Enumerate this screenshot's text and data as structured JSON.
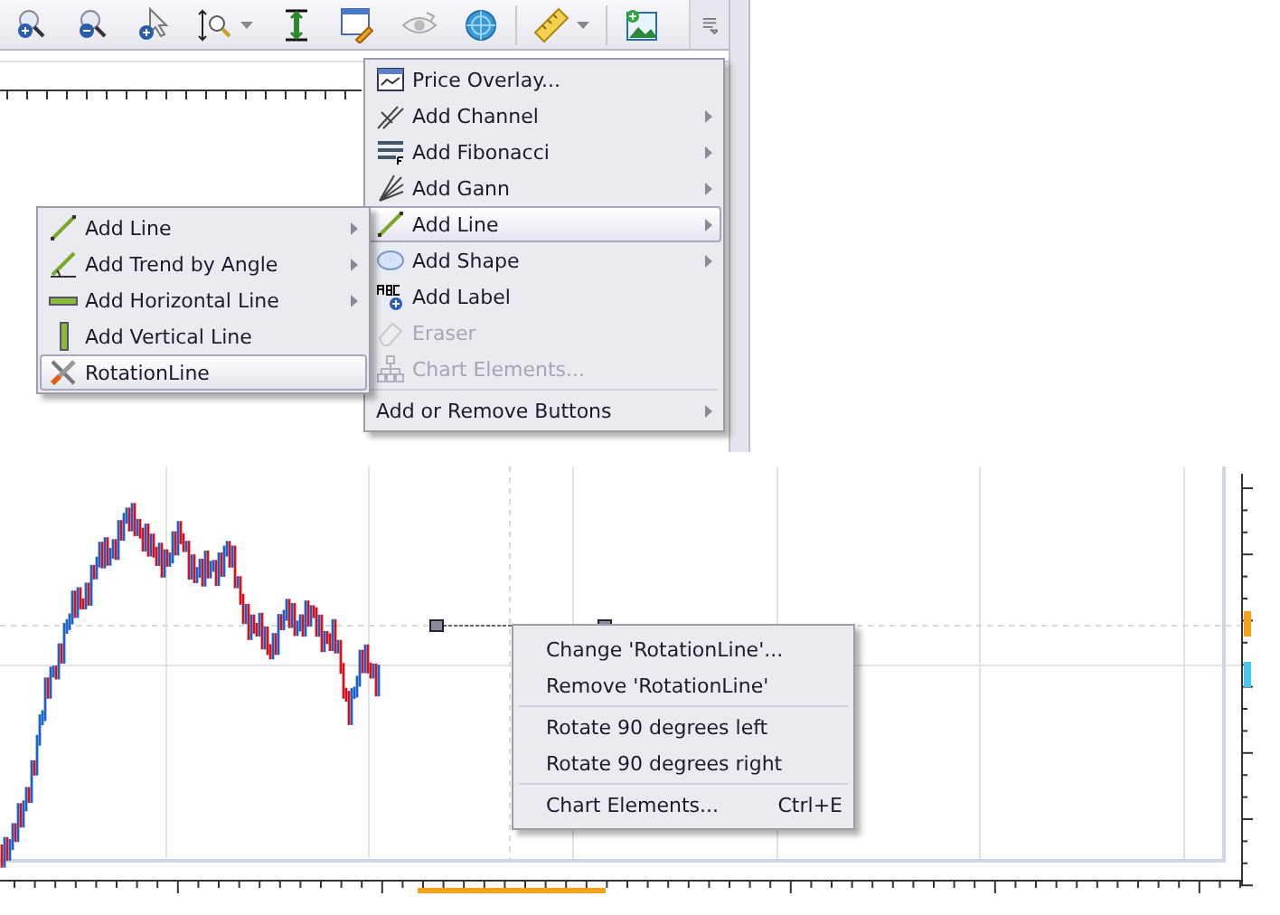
{
  "toolbar": {
    "buttons": [
      {
        "kind": "zoom-in",
        "dropdown": false
      },
      {
        "kind": "zoom-out",
        "dropdown": false
      },
      {
        "kind": "pointer-zoom",
        "dropdown": false
      },
      {
        "kind": "zoom-range",
        "dropdown": true
      },
      {
        "kind": "vertical-fit",
        "dropdown": false
      },
      {
        "kind": "edit-window",
        "dropdown": false
      },
      {
        "kind": "eye",
        "dropdown": false
      },
      {
        "kind": "globe",
        "dropdown": false
      },
      {
        "kind": "ruler",
        "dropdown": true
      },
      {
        "kind": "add-image",
        "dropdown": false
      }
    ]
  },
  "main_menu": {
    "groups": [
      [
        {
          "label": "Price Overlay...",
          "kind": "overlay",
          "submenu": false,
          "disabled": false,
          "selected": false
        },
        {
          "label": "Add Channel",
          "kind": "channel",
          "submenu": true,
          "disabled": false,
          "selected": false
        },
        {
          "label": "Add Fibonacci",
          "kind": "fibonacci",
          "submenu": true,
          "disabled": false,
          "selected": false
        },
        {
          "label": "Add Gann",
          "kind": "gann",
          "submenu": true,
          "disabled": false,
          "selected": false
        },
        {
          "label": "Add Line",
          "kind": "line",
          "submenu": true,
          "disabled": false,
          "selected": true
        },
        {
          "label": "Add Shape",
          "kind": "shape",
          "submenu": true,
          "disabled": false,
          "selected": false
        },
        {
          "label": "Add Label",
          "kind": "label",
          "submenu": false,
          "disabled": false,
          "selected": false
        },
        {
          "label": "Eraser",
          "kind": "eraser",
          "submenu": false,
          "disabled": true,
          "selected": false
        },
        {
          "label": "Chart Elements...",
          "kind": "elements",
          "submenu": false,
          "disabled": true,
          "selected": false
        }
      ],
      [
        {
          "label": "Add or Remove Buttons",
          "kind": "plain",
          "submenu": true,
          "disabled": false,
          "selected": false
        }
      ]
    ]
  },
  "line_submenu": {
    "groups": [
      [
        {
          "label": "Add Line",
          "kind": "line",
          "submenu": true,
          "disabled": false,
          "selected": false
        },
        {
          "label": "Add Trend by Angle",
          "kind": "trend-angle",
          "submenu": true,
          "disabled": false,
          "selected": false
        },
        {
          "label": "Add Horizontal Line",
          "kind": "hline",
          "submenu": true,
          "disabled": false,
          "selected": false
        },
        {
          "label": "Add Vertical Line",
          "kind": "vline",
          "submenu": false,
          "disabled": false,
          "selected": false
        },
        {
          "label": "RotationLine",
          "kind": "wrench",
          "submenu": false,
          "disabled": false,
          "selected": true
        }
      ]
    ]
  },
  "context_menu": {
    "groups": [
      [
        {
          "label": "Change 'RotationLine'..."
        },
        {
          "label": "Remove 'RotationLine'"
        }
      ],
      [
        {
          "label": "Rotate 90 degrees left"
        },
        {
          "label": "Rotate 90 degrees right"
        }
      ],
      [
        {
          "label": "Chart Elements...",
          "shortcut": "Ctrl+E"
        }
      ]
    ]
  }
}
